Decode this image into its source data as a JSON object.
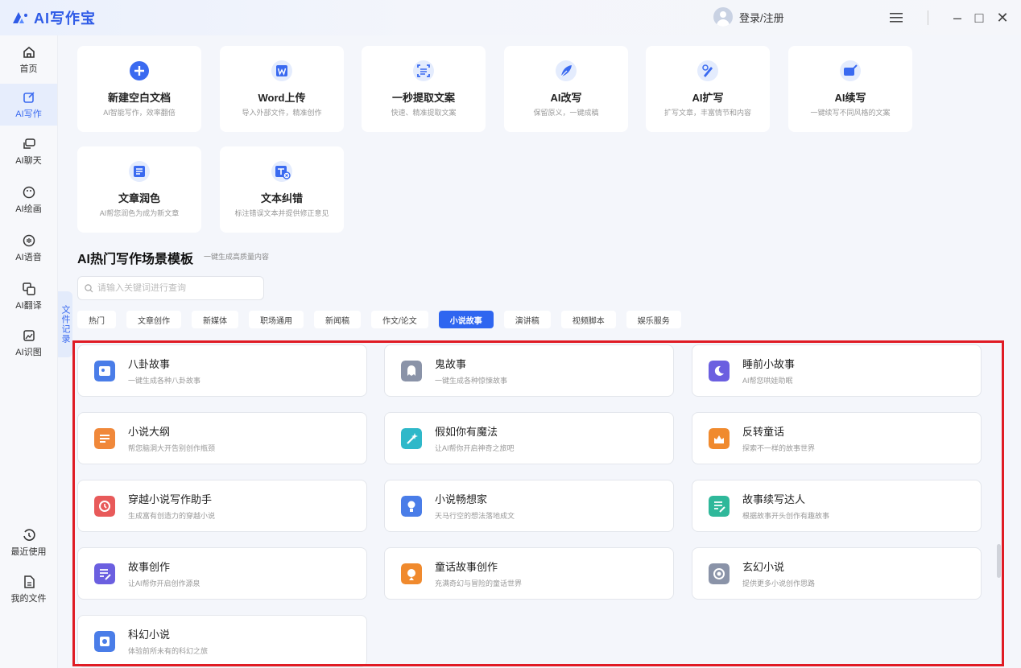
{
  "app": {
    "name": "AI写作宝"
  },
  "titlebar": {
    "login_label": "登录/注册",
    "menu_icon": "hamburger-icon",
    "minimize": "–",
    "maximize": "□",
    "close": "✕"
  },
  "sidebar": {
    "items": [
      {
        "label": "首页",
        "icon": "home-icon"
      },
      {
        "label": "AI写作",
        "icon": "edit-icon",
        "active": true
      },
      {
        "label": "AI聊天",
        "icon": "chat-icon"
      },
      {
        "label": "AI绘画",
        "icon": "palette-icon"
      },
      {
        "label": "AI语音",
        "icon": "voice-icon"
      },
      {
        "label": "AI翻译",
        "icon": "translate-icon"
      },
      {
        "label": "AI识图",
        "icon": "image-recognition-icon"
      }
    ],
    "bottom": [
      {
        "label": "最近使用",
        "icon": "history-icon"
      },
      {
        "label": "我的文件",
        "icon": "file-icon"
      }
    ]
  },
  "side_tab": {
    "label": "文件记录"
  },
  "tools": [
    {
      "title": "新建空白文档",
      "sub": "AI智能写作，效率翻倍",
      "color": "#3a6af0"
    },
    {
      "title": "Word上传",
      "sub": "导入外部文件，精准创作",
      "color": "#3a6af0"
    },
    {
      "title": "一秒提取文案",
      "sub": "快速、精准提取文案",
      "color": "#3a6af0"
    },
    {
      "title": "AI改写",
      "sub": "保留原义，一键成稿",
      "color": "#3a6af0"
    },
    {
      "title": "AI扩写",
      "sub": "扩写文章，丰富情节和内容",
      "color": "#3a6af0"
    },
    {
      "title": "AI续写",
      "sub": "一键续写不同风格的文案",
      "color": "#3a6af0"
    },
    {
      "title": "文章润色",
      "sub": "AI帮您润色为成为新文章",
      "color": "#3a6af0"
    },
    {
      "title": "文本纠错",
      "sub": "标注错误文本并提供修正意见",
      "color": "#3a6af0"
    }
  ],
  "section": {
    "title": "AI热门写作场景模板",
    "subtitle": "一键生成高质量内容"
  },
  "search": {
    "placeholder": "请输入关键词进行查询",
    "value": ""
  },
  "tags": [
    "热门",
    "文章创作",
    "新媒体",
    "职场通用",
    "新闻稿",
    "作文/论文",
    "小说故事",
    "演讲稿",
    "视频脚本",
    "娱乐服务"
  ],
  "active_tag": "小说故事",
  "templates": [
    {
      "title": "八卦故事",
      "sub": "一键生成各种八卦故事",
      "color": "#4a7de8"
    },
    {
      "title": "鬼故事",
      "sub": "一键生成各种惊悚故事",
      "color": "#8a93a8"
    },
    {
      "title": "睡前小故事",
      "sub": "AI帮您哄娃助眠",
      "color": "#6b5fe0"
    },
    {
      "title": "小说大纲",
      "sub": "帮您脑洞大开告别创作瓶颈",
      "color": "#f0883a"
    },
    {
      "title": "假如你有魔法",
      "sub": "让AI帮你开启神奇之旅吧",
      "color": "#2fb8c9"
    },
    {
      "title": "反转童话",
      "sub": "探索不一样的故事世界",
      "color": "#f08a2e"
    },
    {
      "title": "穿越小说写作助手",
      "sub": "生成富有创造力的穿越小说",
      "color": "#e85a5a"
    },
    {
      "title": "小说畅想家",
      "sub": "天马行空的想法落地成文",
      "color": "#4a7de8"
    },
    {
      "title": "故事续写达人",
      "sub": "根据故事开头创作有趣故事",
      "color": "#2fb89a"
    },
    {
      "title": "故事创作",
      "sub": "让AI帮你开启创作源泉",
      "color": "#6b5fe0"
    },
    {
      "title": "童话故事创作",
      "sub": "充满奇幻与冒险的童话世界",
      "color": "#f08a2e"
    },
    {
      "title": "玄幻小说",
      "sub": "提供更多小说创作思路",
      "color": "#8a93a8"
    },
    {
      "title": "科幻小说",
      "sub": "体验前所未有的科幻之旅",
      "color": "#4a7de8"
    }
  ]
}
